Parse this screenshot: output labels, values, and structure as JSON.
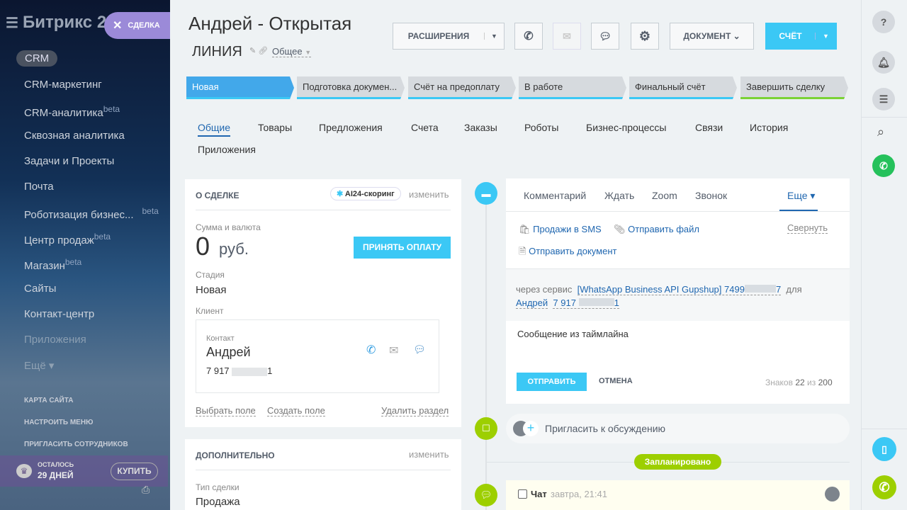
{
  "sidebar": {
    "logo": "Битрикс 24",
    "section": "CRM",
    "items": [
      {
        "label": "CRM-маркетинг",
        "beta": ""
      },
      {
        "label": "CRM-аналитика",
        "beta": "beta"
      },
      {
        "label": "Сквозная аналитика",
        "beta": ""
      },
      {
        "label": "Задачи и Проекты",
        "beta": ""
      },
      {
        "label": "Почта",
        "beta": ""
      },
      {
        "label": "Роботизация бизнес...",
        "beta": "beta"
      },
      {
        "label": "Центр продаж",
        "beta": "beta"
      },
      {
        "label": "Магазин",
        "beta": "beta"
      },
      {
        "label": "Сайты",
        "beta": ""
      },
      {
        "label": "Контакт-центр",
        "beta": ""
      },
      {
        "label": "Приложения",
        "beta": ""
      },
      {
        "label": "Ещё ▾",
        "beta": ""
      }
    ],
    "links": [
      "КАРТА САЙТА",
      "НАСТРОИТЬ МЕНЮ",
      "ПРИГЛАСИТЬ СОТРУДНИКОВ"
    ],
    "trial_label": "ОСТАЛОСЬ",
    "trial_days": "29 ДНЕЙ",
    "buy": "КУПИТЬ"
  },
  "deal_pill": "СДЕЛКА",
  "header": {
    "title_line1": "Андрей - Открытая",
    "title_line2": "ЛИНИЯ",
    "category": "Общее",
    "extensions": "РАСШИРЕНИЯ",
    "document": "ДОКУМЕНТ",
    "invoice": "СЧЁТ"
  },
  "stages": [
    "Новая",
    "Подготовка докумен...",
    "Счёт на предоплату",
    "В работе",
    "Финальный счёт",
    "Завершить сделку"
  ],
  "tabs": [
    "Общие",
    "Товары",
    "Предложения",
    "Счета",
    "Заказы",
    "Роботы",
    "Бизнес-процессы",
    "Связи",
    "История",
    "Приложения"
  ],
  "about": {
    "title": "О СДЕЛКЕ",
    "scoring": "AI24-скоринг",
    "edit": "изменить",
    "sum_label": "Сумма и валюта",
    "sum": "0",
    "currency": "руб.",
    "pay": "ПРИНЯТЬ ОПЛАТУ",
    "stage_label": "Стадия",
    "stage": "Новая",
    "client_label": "Клиент",
    "contact_label": "Контакт",
    "contact_name": "Андрей",
    "phone_start": "7 917",
    "phone_end": "1",
    "select_field": "Выбрать поле",
    "create_field": "Создать поле",
    "delete_section": "Удалить раздел"
  },
  "extra": {
    "title": "ДОПОЛНИТЕЛЬНО",
    "edit": "изменить",
    "type_label": "Тип сделки",
    "type": "Продажа"
  },
  "timeline": {
    "tabs": [
      "Комментарий",
      "Ждать",
      "Zoom",
      "Звонок",
      "Еще ▾"
    ],
    "sms": "Продажи в SMS",
    "send_file": "Отправить файл",
    "collapse": "Свернуть",
    "send_doc": "Отправить документ",
    "via": "через сервис",
    "service": "[WhatsApp Business API Gupshup] 7499",
    "service_end": "7",
    "for": "для",
    "to_name": "Андрей",
    "to_phone": "7 917",
    "to_phone_end": "1",
    "message": "Сообщение из таймлайна",
    "send": "ОТПРАВИТЬ",
    "cancel": "ОТМЕНА",
    "chars_label": "Знаков",
    "chars": "22",
    "of": "из",
    "max": "200",
    "invite": "Пригласить к обсуждению",
    "planned": "Запланировано",
    "chat_title": "Чат",
    "chat_time": "завтра, 21:41"
  }
}
